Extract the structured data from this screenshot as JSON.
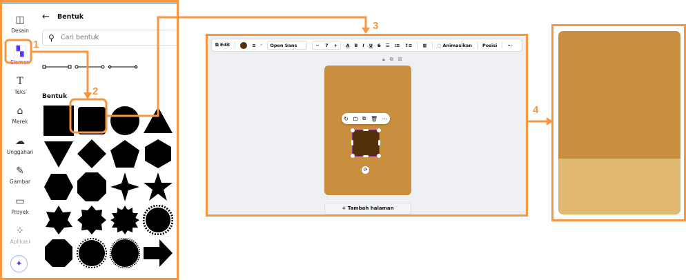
{
  "sidebar": {
    "items": [
      {
        "label": "Desain",
        "icon": "layout-icon"
      },
      {
        "label": "Elemen",
        "icon": "shapes-icon"
      },
      {
        "label": "Teks",
        "icon": "text-icon"
      },
      {
        "label": "Merek",
        "icon": "brand-icon"
      },
      {
        "label": "Unggahan",
        "icon": "upload-icon"
      },
      {
        "label": "Gambar",
        "icon": "draw-icon"
      },
      {
        "label": "Proyek",
        "icon": "folder-icon"
      },
      {
        "label": "Aplikasi",
        "icon": "apps-icon"
      }
    ]
  },
  "panel": {
    "title": "Bentuk",
    "search_placeholder": "Cari bentuk",
    "section": "Bentuk"
  },
  "toolbar": {
    "edit": "Edit",
    "font": "Open Sans",
    "font_size": "7",
    "animate": "Animasikan",
    "position": "Posisi",
    "fill_color": "#532f0a"
  },
  "canvas": {
    "add_page": "Tambah halaman",
    "page_color": "#c98f3e",
    "shape_color": "#532f0a"
  },
  "result": {
    "top_color": "#c98f3e",
    "bottom_color": "#e0b872"
  },
  "steps": [
    "1",
    "2",
    "3",
    "4"
  ],
  "colors": {
    "accent": "#f7963f"
  }
}
